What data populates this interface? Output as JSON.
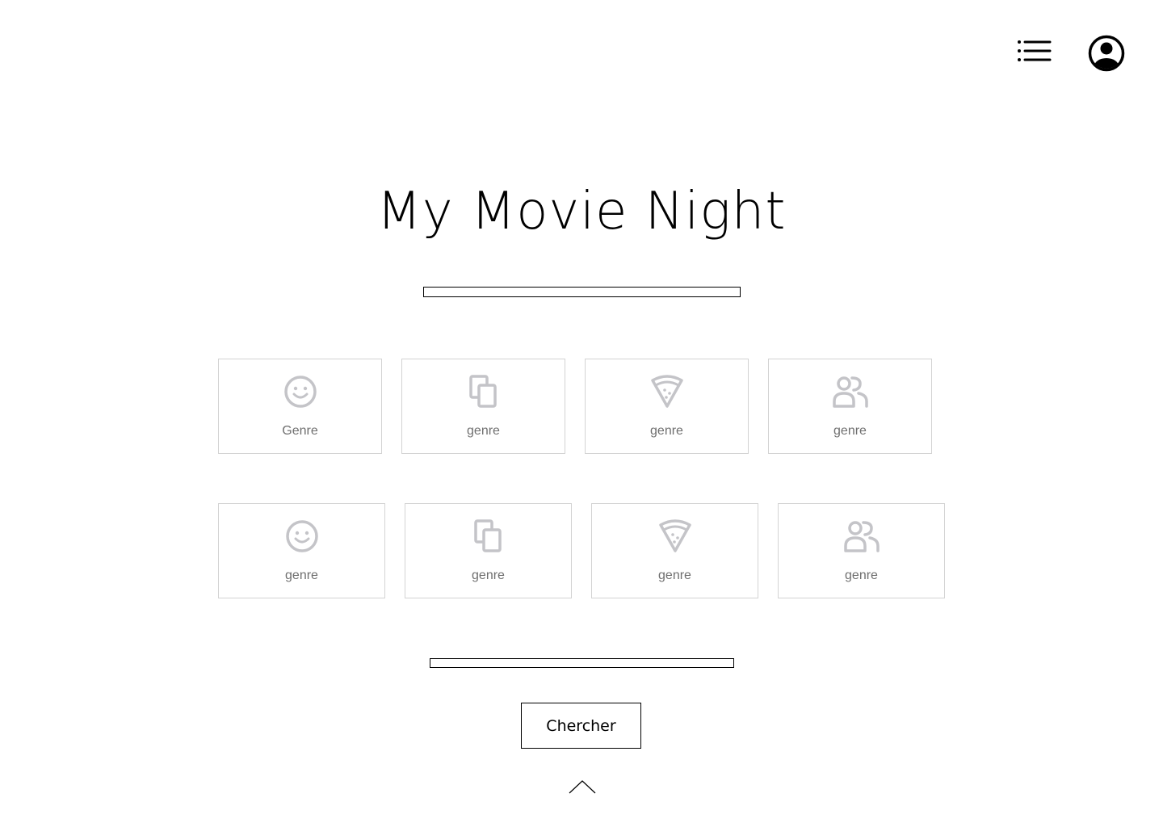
{
  "header": {
    "menu_icon": "list-menu-icon",
    "profile_icon": "user-circle-icon"
  },
  "title": "My Movie Night",
  "search": {
    "placeholder": ""
  },
  "genres_row1": [
    {
      "label": "Genre",
      "icon": "smiley-icon"
    },
    {
      "label": "genre",
      "icon": "copy-icon"
    },
    {
      "label": "genre",
      "icon": "pizza-icon"
    },
    {
      "label": "genre",
      "icon": "users-icon"
    }
  ],
  "genres_row2": [
    {
      "label": "genre",
      "icon": "smiley-icon"
    },
    {
      "label": "genre",
      "icon": "copy-icon"
    },
    {
      "label": "genre",
      "icon": "pizza-icon"
    },
    {
      "label": "genre",
      "icon": "users-icon"
    }
  ],
  "second_input": {
    "placeholder": ""
  },
  "search_button": "Chercher",
  "scroll_up_icon": "chevron-up-icon",
  "colors": {
    "icon_gray": "#c4c4c8",
    "label_gray": "#6f6f6f",
    "card_border": "#d3d3d3"
  }
}
